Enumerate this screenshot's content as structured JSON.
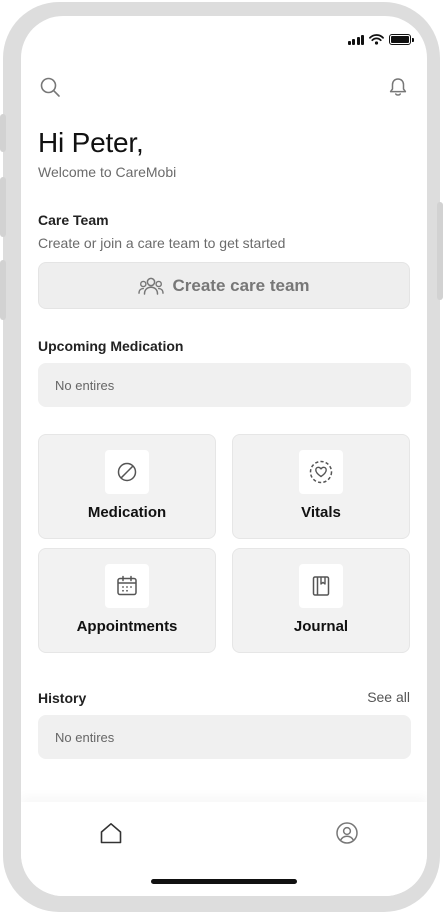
{
  "status_bar": {
    "icons": [
      "cellular-signal-icon",
      "wifi-icon",
      "battery-icon"
    ]
  },
  "header": {
    "search_icon": "search-icon",
    "notification_icon": "bell-icon"
  },
  "greeting": {
    "title": "Hi Peter,",
    "subtitle": "Welcome to CareMobi"
  },
  "care_team": {
    "title": "Care Team",
    "subtitle": "Create or join a care team to get started",
    "button_label": "Create care team",
    "button_icon": "users-icon"
  },
  "upcoming_medication": {
    "title": "Upcoming Medication",
    "empty_text": "No entires"
  },
  "shortcuts": [
    {
      "label": "Medication",
      "icon": "pill-icon"
    },
    {
      "label": "Vitals",
      "icon": "heart-rate-icon"
    },
    {
      "label": "Appointments",
      "icon": "calendar-icon"
    },
    {
      "label": "Journal",
      "icon": "journal-icon"
    }
  ],
  "history": {
    "title": "History",
    "see_all": "See all",
    "empty_text": "No entires"
  },
  "bottom_nav": {
    "items": [
      {
        "icon": "home-icon"
      },
      {
        "icon": "profile-icon"
      }
    ]
  },
  "colors": {
    "frame": "#dddddd",
    "card_bg": "#f2f2f2",
    "text_primary": "#111111",
    "text_secondary": "#6b6b6b"
  }
}
